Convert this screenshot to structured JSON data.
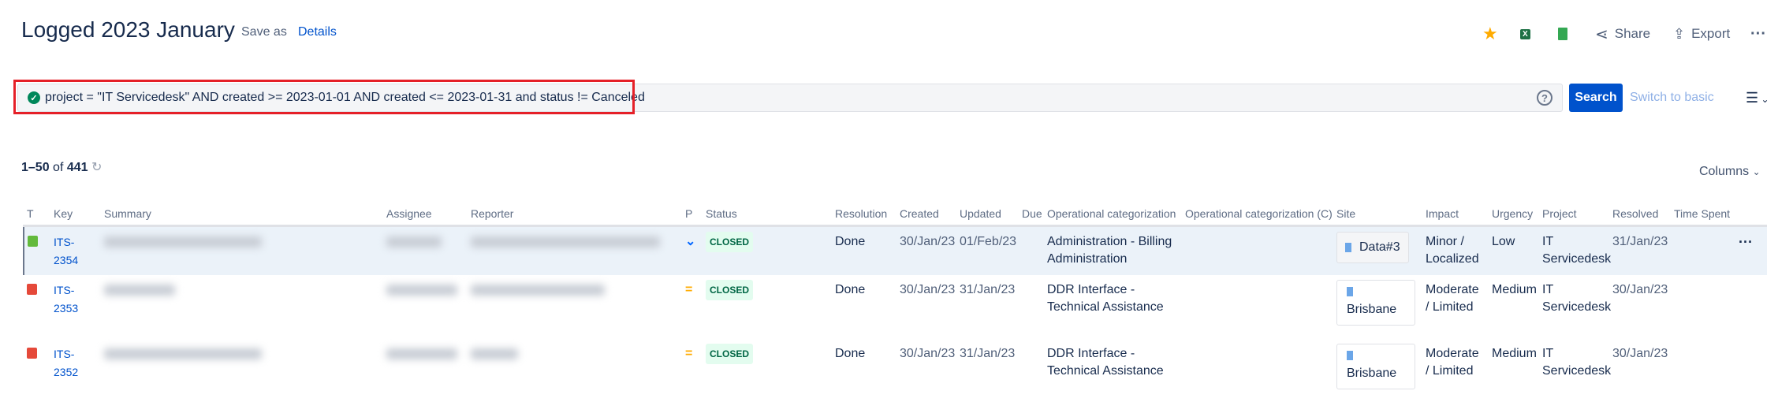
{
  "header": {
    "title": "Logged 2023 January",
    "save_as": "Save as",
    "details": "Details",
    "share": "Share",
    "export": "Export"
  },
  "colors": {
    "accent": "#0052cc",
    "star": "#ffab00",
    "closed_bg": "#e3fcef",
    "closed_fg": "#006644",
    "query_outline": "#e52028"
  },
  "query": {
    "jql": "project = \"IT Servicedesk\" AND created >= 2023-01-01 AND created <= 2023-01-31 and status != Canceled",
    "search": "Search",
    "switch": "Switch to basic"
  },
  "results": {
    "range": "1–50",
    "of": "of",
    "total": "441",
    "columns_label": "Columns"
  },
  "columns": [
    "T",
    "Key",
    "Summary",
    "Assignee",
    "Reporter",
    "P",
    "Status",
    "Resolution",
    "Created",
    "Updated",
    "Due",
    "Operational categorization",
    "Operational categorization (C)",
    "Site",
    "Impact",
    "Urgency",
    "Project",
    "Resolved",
    "Time Spent"
  ],
  "rows": [
    {
      "type_color": "#63ba3c",
      "key": "ITS-2354",
      "priority": "low",
      "status": "CLOSED",
      "resolution": "Done",
      "created": "30/Jan/23",
      "updated": "01/Feb/23",
      "opcat": "Administration - Billing Administration",
      "site": "Data#3",
      "impact": "Minor / Localized",
      "urgency": "Low",
      "project": "IT Servicedesk",
      "resolved": "31/Jan/23"
    },
    {
      "type_color": "#e5493a",
      "key": "ITS-2353",
      "priority": "medium",
      "status": "CLOSED",
      "resolution": "Done",
      "created": "30/Jan/23",
      "updated": "31/Jan/23",
      "opcat": "DDR Interface - Technical Assistance",
      "site": "Brisbane",
      "impact": "Moderate / Limited",
      "urgency": "Medium",
      "project": "IT Servicedesk",
      "resolved": "30/Jan/23"
    },
    {
      "type_color": "#e5493a",
      "key": "ITS-2352",
      "priority": "medium",
      "status": "CLOSED",
      "resolution": "Done",
      "created": "30/Jan/23",
      "updated": "31/Jan/23",
      "opcat": "DDR Interface - Technical Assistance",
      "site": "Brisbane",
      "impact": "Moderate / Limited",
      "urgency": "Medium",
      "project": "IT Servicedesk",
      "resolved": "30/Jan/23"
    }
  ]
}
